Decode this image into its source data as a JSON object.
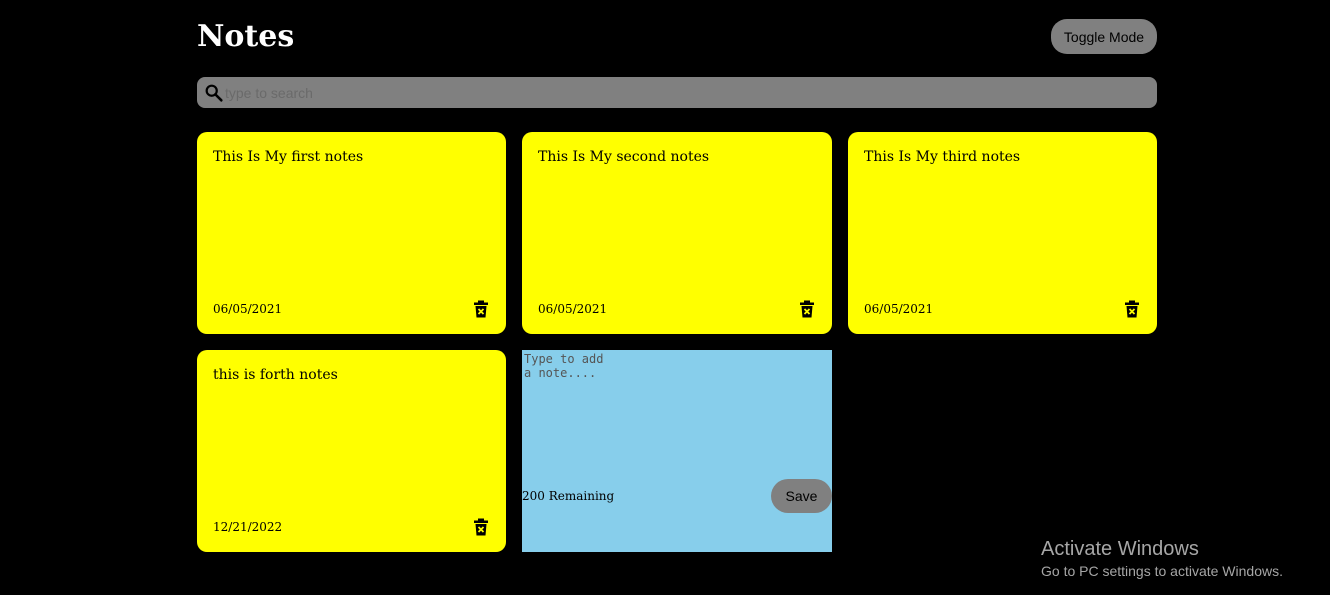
{
  "header": {
    "title": "Notes",
    "toggle_label": "Toggle Mode"
  },
  "search": {
    "placeholder": "type to search",
    "value": ""
  },
  "notes": [
    {
      "text": "This Is My first notes",
      "date": "06/05/2021"
    },
    {
      "text": "This Is My second notes",
      "date": "06/05/2021"
    },
    {
      "text": "This Is My third notes",
      "date": "06/05/2021"
    },
    {
      "text": "this is forth notes",
      "date": "12/21/2022"
    }
  ],
  "new_note": {
    "placeholder": "Type to add a note....",
    "remaining": "200 Remaining",
    "save_label": "Save"
  },
  "watermark": {
    "title": "Activate Windows",
    "subtitle": "Go to PC settings to activate Windows."
  },
  "colors": {
    "background": "#000000",
    "note": "#ffff00",
    "new_note": "#87ceeb",
    "button": "#808080"
  },
  "icons": {
    "search": "search-icon",
    "delete": "delete-icon"
  }
}
